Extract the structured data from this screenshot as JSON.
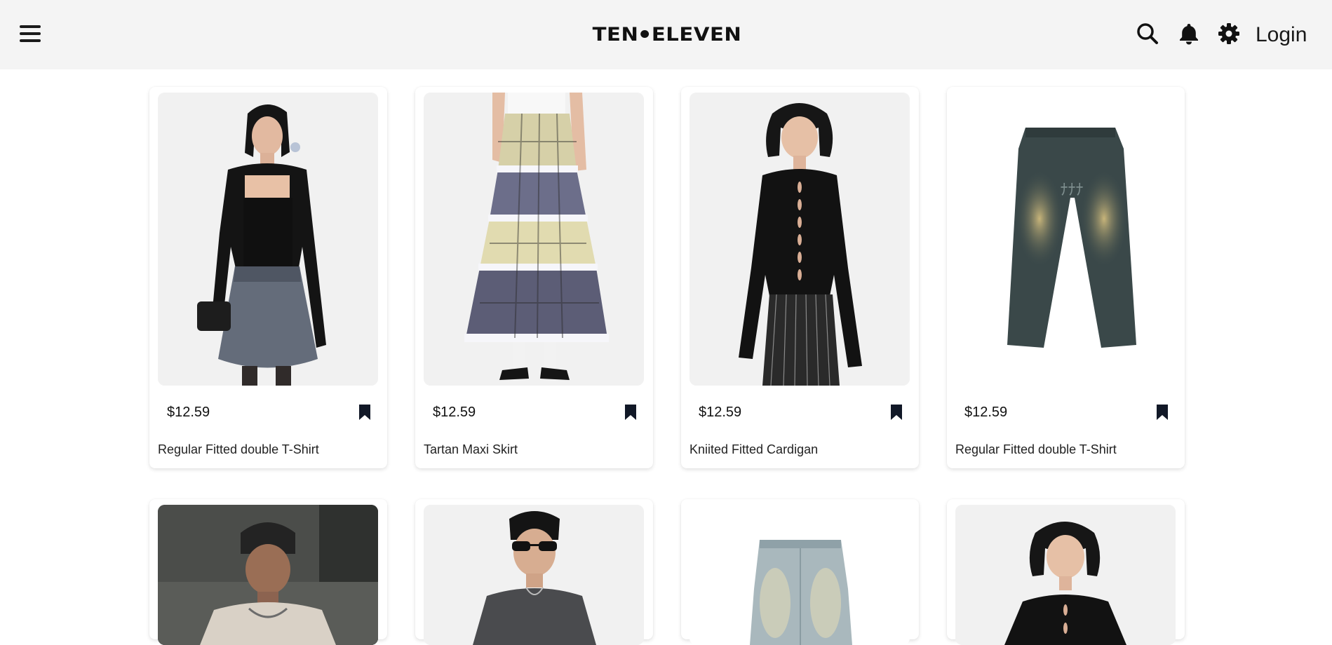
{
  "header": {
    "menu_icon": "hamburger-menu-icon",
    "logo_left": "TEN",
    "logo_right": "ELEVEN",
    "search_icon": "search-icon",
    "bell_icon": "bell-icon",
    "gear_icon": "gear-icon",
    "login_label": "Login"
  },
  "colors": {
    "header_bg": "#f4f4f4",
    "text": "#111827",
    "bookmark": "#111827"
  },
  "products": [
    {
      "price": "$12.59",
      "name": "Regular Fitted double T-Shirt",
      "image": "model-black-top-grey-skirt"
    },
    {
      "price": "$12.59",
      "name": "Tartan Maxi Skirt",
      "image": "plaid-tiered-maxi-skirt"
    },
    {
      "price": "$12.59",
      "name": "Kniited Fitted Cardigan",
      "image": "model-black-keyhole-cardigan"
    },
    {
      "price": "$12.59",
      "name": "Regular Fitted double T-Shirt",
      "image": "washed-wide-leg-jeans"
    },
    {
      "image": "man-beige-tee-beanie"
    },
    {
      "image": "man-sunglasses-grey-sweatshirt"
    },
    {
      "image": "light-wash-jeans"
    },
    {
      "image": "model-black-keyhole-cardigan"
    }
  ]
}
